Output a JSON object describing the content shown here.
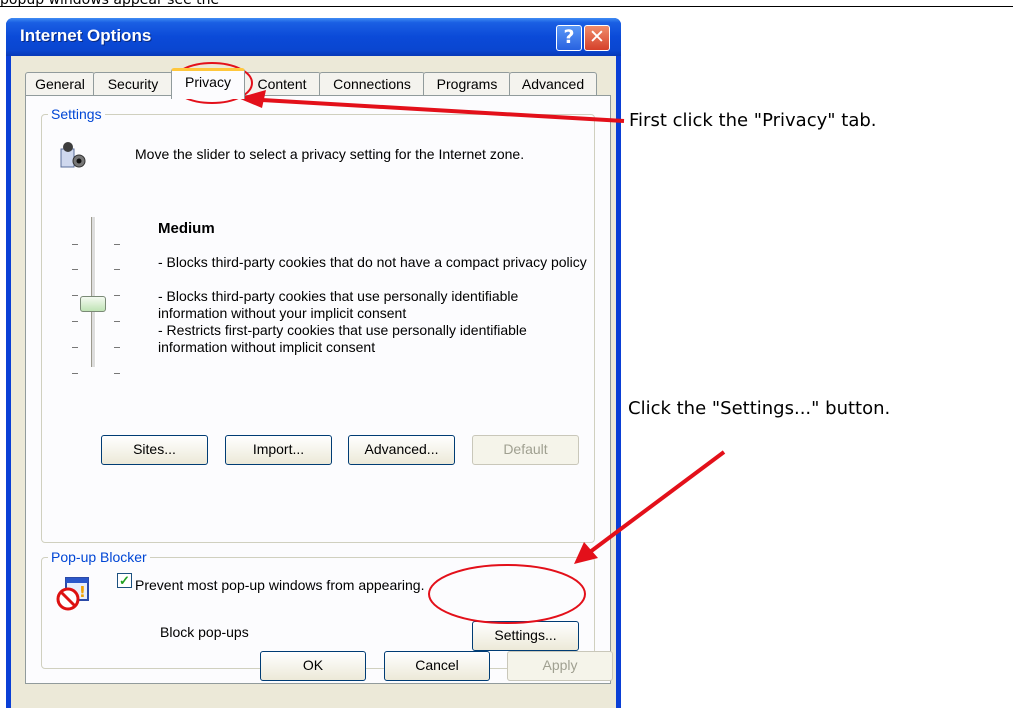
{
  "top_crop_text": "popup windows appear see the",
  "window": {
    "title": "Internet Options",
    "help_label": "?",
    "close_label": "✕"
  },
  "tabs": [
    {
      "label": "General"
    },
    {
      "label": "Security"
    },
    {
      "label": "Privacy",
      "active": true
    },
    {
      "label": "Content"
    },
    {
      "label": "Connections"
    },
    {
      "label": "Programs"
    },
    {
      "label": "Advanced"
    }
  ],
  "settings": {
    "label": "Settings",
    "description": "Move the slider to select a privacy setting for the Internet zone.",
    "level": "Medium",
    "level_lines": [
      "- Blocks third-party cookies that do not have a compact privacy policy",
      "- Blocks third-party cookies that use personally identifiable information without your implicit consent",
      "- Restricts first-party cookies that use personally identifiable information without implicit consent"
    ],
    "slider_position": "3 of 6",
    "buttons": {
      "sites": "Sites...",
      "import": "Import...",
      "advanced": "Advanced...",
      "default": "Default"
    }
  },
  "popup": {
    "label": "Pop-up Blocker",
    "description": "Prevent most pop-up windows from appearing.",
    "checkbox_label": "Block pop-ups",
    "checkbox_checked": true,
    "settings_button": "Settings..."
  },
  "footer": {
    "ok": "OK",
    "cancel": "Cancel",
    "apply": "Apply"
  },
  "annotations": {
    "first": "First click the \"Privacy\" tab.",
    "second": "Click the \"Settings...\" button."
  },
  "colors": {
    "annotation_red": "#e3101a",
    "titlebar_blue": "#0b4ad8",
    "group_label_blue": "#0046d5"
  },
  "icons": {
    "privacy": "privacy-person-icon",
    "popup": "popup-blocker-icon"
  }
}
